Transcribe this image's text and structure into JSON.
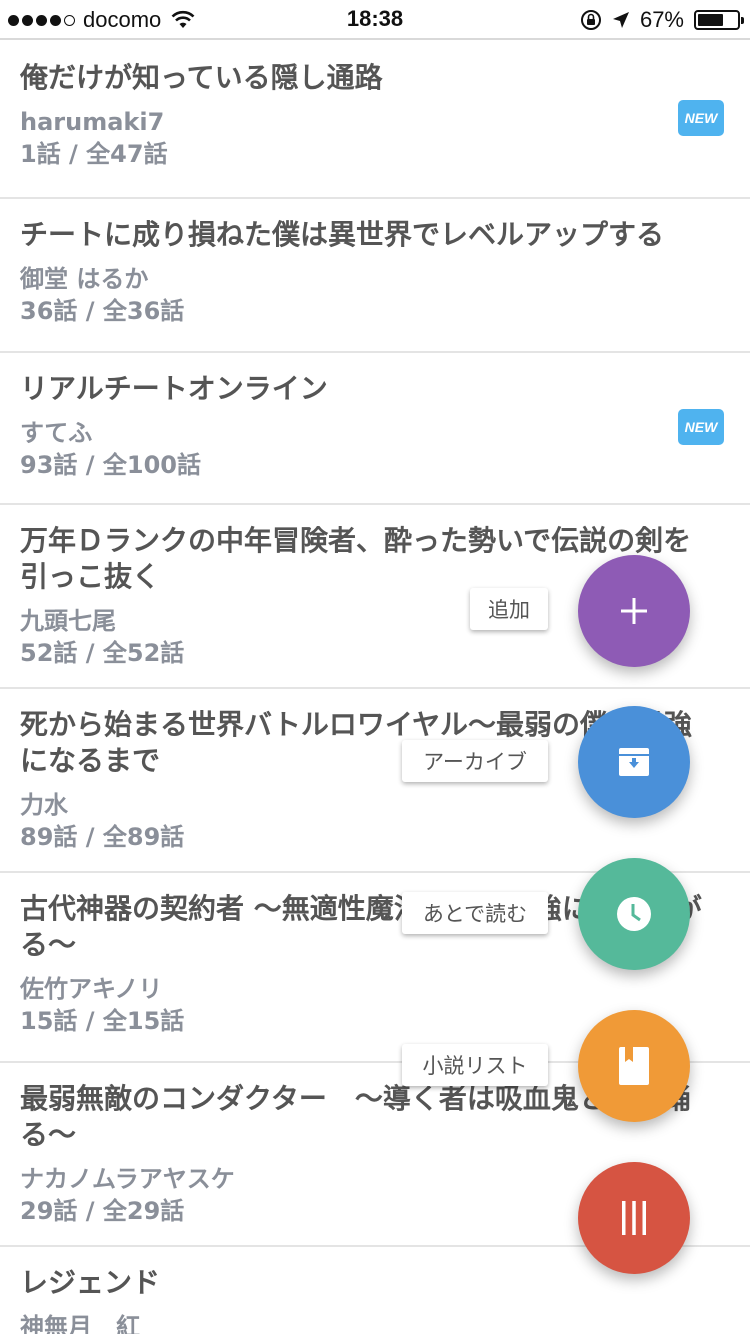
{
  "status_bar": {
    "carrier": "docomo",
    "time": "18:38",
    "battery": "67%",
    "battery_level": 0.67,
    "signal_bars_filled": 4,
    "signal_bars_total": 5
  },
  "badge_label": "NEW",
  "novels": [
    {
      "title": "俺だけが知っている隠し通路",
      "author": "harumaki7",
      "count": "1話 / 全47話",
      "is_new": true
    },
    {
      "title": "チートに成り損ねた僕は異世界でレベルアップする",
      "author": "御堂 はるか",
      "count": "36話 / 全36話",
      "is_new": false
    },
    {
      "title": "リアルチートオンライン",
      "author": "すてふ",
      "count": "93話 / 全100話",
      "is_new": true
    },
    {
      "title": "万年Ｄランクの中年冒険者、酔った勢いで伝説の剣を引っこ抜く",
      "author": "九頭七尾",
      "count": "52話 / 全52話",
      "is_new": false
    },
    {
      "title": "死から始まる世界バトルロワイヤル〜最弱の僕が最強になるまで",
      "author": "力水",
      "count": "89話 / 全89話",
      "is_new": false
    },
    {
      "title": "古代神器の契約者 〜無適性魔法使いが最強に成り上がる〜",
      "author": "佐竹アキノリ",
      "count": "15話 / 全15話",
      "is_new": false
    },
    {
      "title": "最弱無敵のコンダクター　〜導く者は吸血鬼と共に踊る〜",
      "author": "ナカノムラアヤスケ",
      "count": "29話 / 全29話",
      "is_new": false
    },
    {
      "title": "レジェンド",
      "author": "神無月　紅",
      "count": "",
      "is_new": false
    }
  ],
  "fab_menu": {
    "add": {
      "label": "追加",
      "color": "#8e5bb5",
      "icon": "plus-icon"
    },
    "archive": {
      "label": "アーカイブ",
      "color": "#4a90d9",
      "icon": "archive-icon"
    },
    "read_later": {
      "label": "あとで読む",
      "color": "#55b99a",
      "icon": "clock-icon"
    },
    "novel_list": {
      "label": "小説リスト",
      "color": "#f09a37",
      "icon": "book-icon"
    },
    "menu": {
      "color": "#d65442",
      "icon": "menu-bars-icon"
    }
  }
}
